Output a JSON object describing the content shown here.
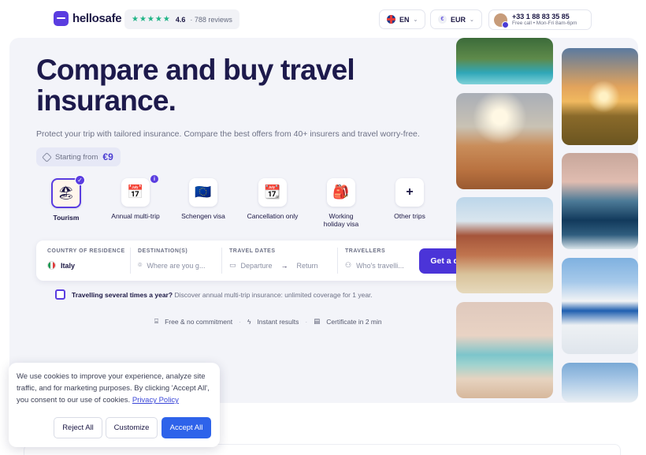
{
  "header": {
    "logo_text": "hellosafe",
    "rating": {
      "stars": "★★★★★",
      "score": "4.6",
      "reviews": "· 788 reviews"
    },
    "language": "EN",
    "currency": "EUR",
    "phone": {
      "number": "+33 1 88 83 35 85",
      "sub": "Free call • Mon-Fri 8am-6pm"
    }
  },
  "hero": {
    "title": "Compare and buy travel insurance.",
    "subtitle": "Protect your trip with tailored insurance. Compare the best offers from 40+ insurers and travel worry-free.",
    "starting_label": "Starting from",
    "starting_price": "€9"
  },
  "categories": [
    {
      "label": "Tourism",
      "icon": "🏖",
      "selected": true
    },
    {
      "label": "Annual multi-trip",
      "icon": "📅",
      "selected": false
    },
    {
      "label": "Schengen visa",
      "icon": "🇪🇺",
      "selected": false
    },
    {
      "label": "Cancellation only",
      "icon": "📆",
      "selected": false
    },
    {
      "label": "Working holiday visa",
      "icon": "🎒",
      "selected": false
    },
    {
      "label": "Other trips",
      "icon": "+",
      "selected": false
    }
  ],
  "form": {
    "residence_label": "COUNTRY OF RESIDENCE",
    "residence_value": "Italy",
    "destination_label": "DESTINATION(S)",
    "destination_placeholder": "Where are you g...",
    "dates_label": "TRAVEL DATES",
    "departure": "Departure",
    "return": "Return",
    "travellers_label": "TRAVELLERS",
    "travellers_placeholder": "Who's travelli...",
    "quote_button": "Get a quote"
  },
  "multi_trip": {
    "bold": "Travelling several times a year?",
    "text": "Discover annual multi-trip insurance: unlimited coverage for 1 year."
  },
  "perks": [
    "Free & no commitment",
    "Instant results",
    "Certificate in 2 min"
  ],
  "cookie": {
    "text": "We use cookies to improve your experience, analyze site traffic, and for marketing purposes. By clicking 'Accept All', you consent to our use of cookies.",
    "policy_link": "Privacy Policy",
    "reject": "Reject All",
    "customize": "Customize",
    "accept": "Accept All"
  },
  "colors": {
    "accent": "#4b34d8",
    "title": "#1d1a4c",
    "cookie_accept": "#2e63ea"
  }
}
